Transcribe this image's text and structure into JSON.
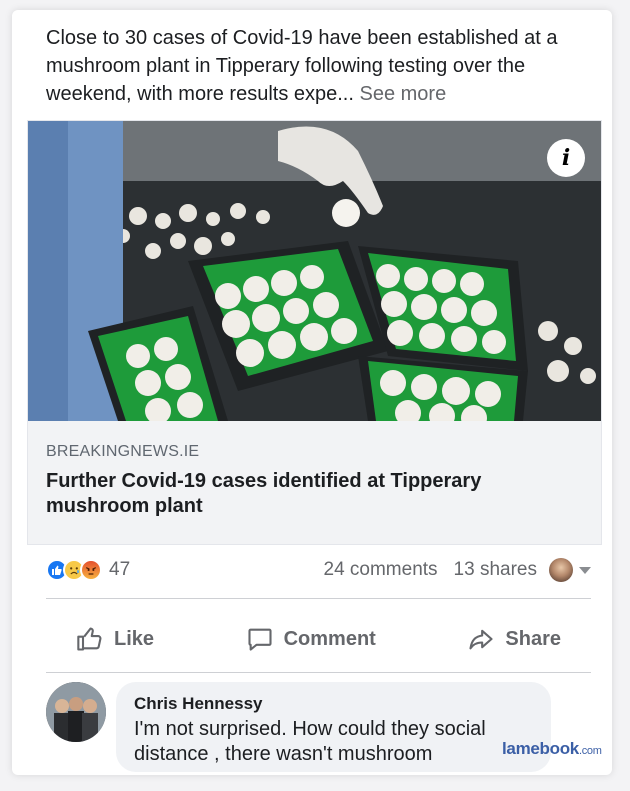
{
  "post": {
    "text": "Close to 30 cases of Covid-19 have been established at a mushroom plant in Tipperary following testing over the weekend, with more results expe...",
    "see_more": "See more"
  },
  "link_preview": {
    "domain": "BREAKINGNEWS.IE",
    "headline": "Further Covid-19 cases identified at Tipperary mushroom plant",
    "info_icon": "i"
  },
  "stats": {
    "reaction_count": "47",
    "reactions": [
      "like-icon",
      "sad-icon",
      "angry-icon"
    ],
    "comments": "24 comments",
    "shares": "13 shares"
  },
  "actions": {
    "like": "Like",
    "comment": "Comment",
    "share": "Share"
  },
  "comment": {
    "author": "Chris Hennessy",
    "text": "I'm not surprised. How could they social distance , there wasn't mushroom"
  },
  "watermark": {
    "brand": "lamebook",
    "suffix": ".com"
  },
  "colors": {
    "like_blue": "#1877f2",
    "text_secondary": "#65676b",
    "preview_bg": "#f2f3f5",
    "bubble_bg": "#f0f2f5"
  }
}
